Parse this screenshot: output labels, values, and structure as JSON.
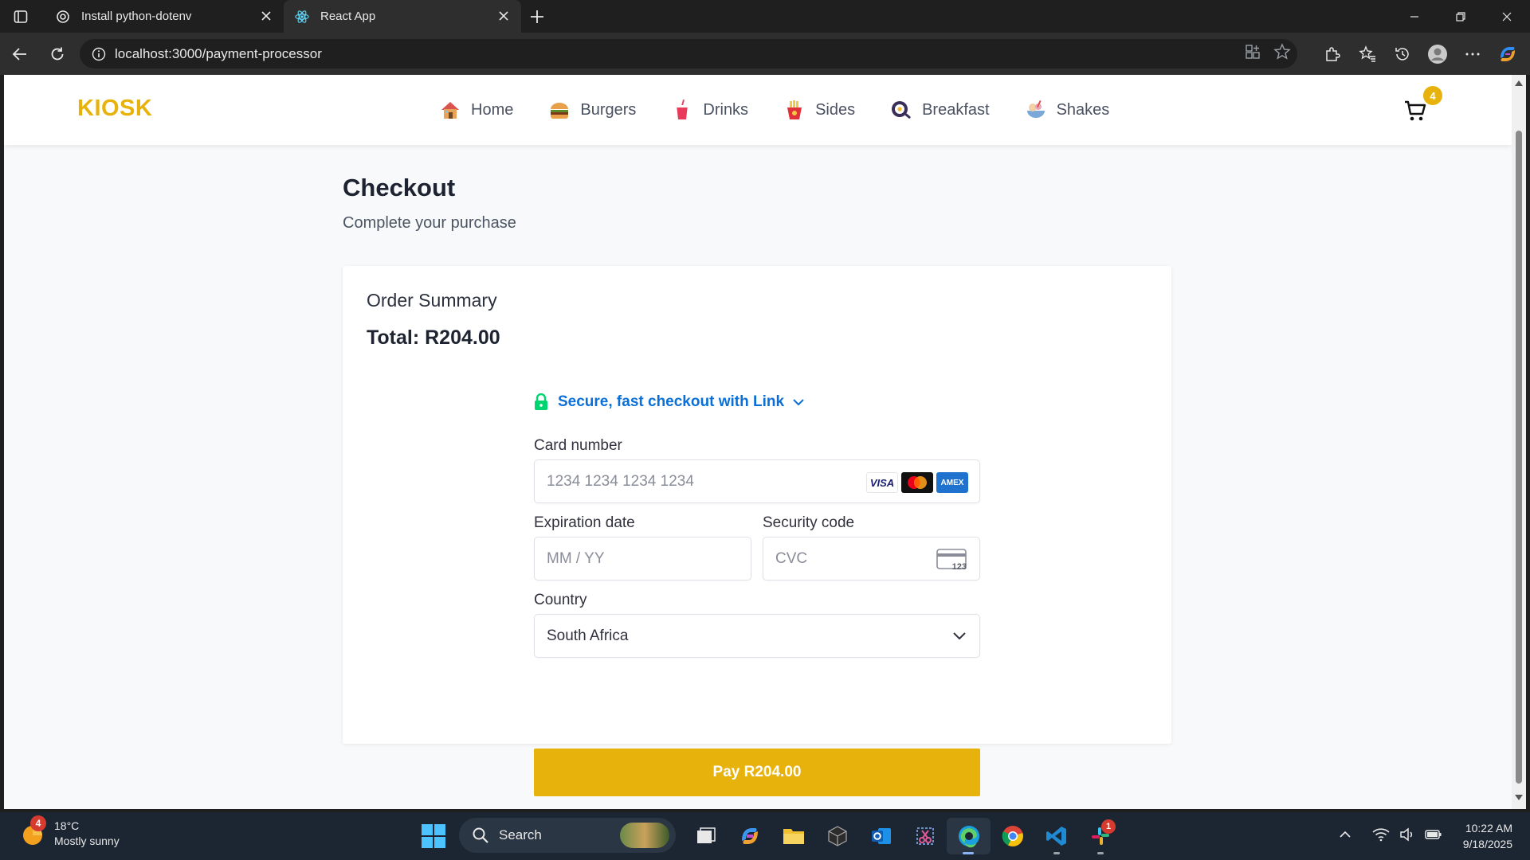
{
  "browser": {
    "tabs": [
      {
        "title": "Install python-dotenv",
        "icon": "chatgpt-icon",
        "active": false
      },
      {
        "title": "React App",
        "icon": "react-icon",
        "active": true
      }
    ],
    "url": "localhost:3000/payment-processor"
  },
  "app": {
    "brand": "KIOSK",
    "nav": [
      {
        "label": "Home",
        "icon": "house-icon"
      },
      {
        "label": "Burgers",
        "icon": "burger-icon"
      },
      {
        "label": "Drinks",
        "icon": "drink-icon"
      },
      {
        "label": "Sides",
        "icon": "fries-icon"
      },
      {
        "label": "Breakfast",
        "icon": "pan-icon"
      },
      {
        "label": "Shakes",
        "icon": "shake-icon"
      }
    ],
    "cart_count": "4",
    "accent_color": "#e8b20c"
  },
  "checkout": {
    "title": "Checkout",
    "subtitle": "Complete your purchase",
    "summary_label": "Order Summary",
    "total": "Total: R204.00",
    "link_text": "Secure, fast checkout with Link",
    "card_number_label": "Card number",
    "card_number_placeholder": "1234 1234 1234 1234",
    "expiry_label": "Expiration date",
    "expiry_placeholder": "MM / YY",
    "security_label": "Security code",
    "security_placeholder": "CVC",
    "country_label": "Country",
    "country_value": "South Africa",
    "pay_button": "Pay R204.00",
    "card_brands": [
      "VISA",
      "mastercard",
      "AMEX"
    ],
    "cvc_hint": "123"
  },
  "taskbar": {
    "weather_temp": "18°C",
    "weather_desc": "Mostly sunny",
    "weather_badge": "4",
    "search_label": "Search",
    "time": "10:22 AM",
    "date": "9/18/2025",
    "slack_badge": "1"
  }
}
